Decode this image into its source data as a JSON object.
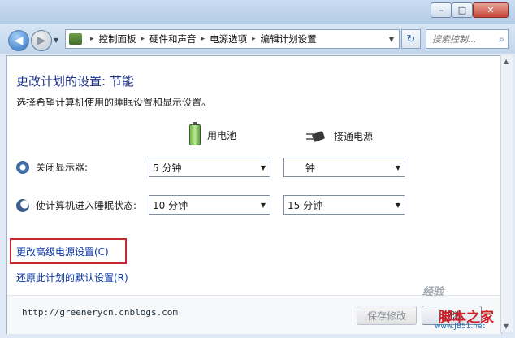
{
  "window": {
    "minimize": "–",
    "maximize": "□",
    "close": "✕"
  },
  "nav": {
    "back": "◀",
    "forward": "▶",
    "dropdown": "▼",
    "refresh": "↻"
  },
  "breadcrumb": [
    "控制面板",
    "硬件和声音",
    "电源选项",
    "编辑计划设置"
  ],
  "breadcrumb_sep": "▸",
  "search": {
    "placeholder": "搜索控制...",
    "icon": "⌕"
  },
  "page": {
    "title": "更改计划的设置: 节能",
    "description": "选择希望计算机使用的睡眠设置和显示设置。",
    "columns": {
      "battery": "用电池",
      "plugged": "接通电源"
    },
    "settings": [
      {
        "label": "关闭显示器:",
        "battery_value": "5 分钟",
        "plugged_value": "钟"
      },
      {
        "label": "使计算机进入睡眠状态:",
        "battery_value": "10 分钟",
        "plugged_value": "15 分钟"
      }
    ],
    "links": {
      "advanced": "更改高级电源设置(C)",
      "restore": "还原此计划的默认设置(R)"
    },
    "footer": {
      "url": "http://greenerycn.cnblogs.com",
      "save": "保存修改",
      "cancel": "取消"
    }
  },
  "watermarks": {
    "main": "脚本之家",
    "sub": "www.JB51.net",
    "top": "经验",
    "ghost": "www.   .com"
  },
  "colors": {
    "title": "#1e3287",
    "link": "#0a36a8",
    "highlight": "#c8262f"
  }
}
